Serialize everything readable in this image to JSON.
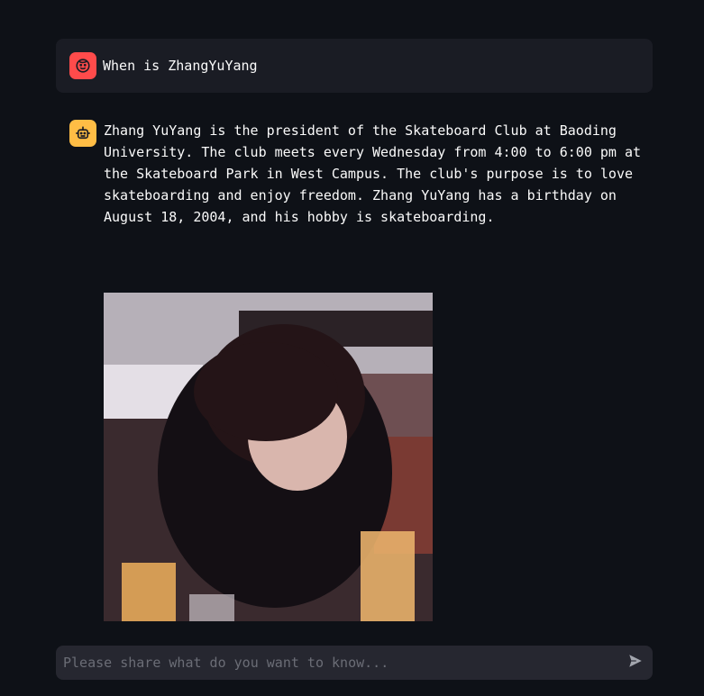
{
  "conversation": {
    "user_message": {
      "avatar_icon": "user-face-icon",
      "avatar_color": "#ff4b4b",
      "text": "When is ZhangYuYang"
    },
    "assistant_message": {
      "avatar_icon": "robot-icon",
      "avatar_color": "#ffbd45",
      "text": "Zhang YuYang is the president of the Skateboard Club at Baoding University. The club meets every Wednesday from 4:00 to 6:00 pm at the Skateboard Park in West Campus. The club's purpose is to love skateboarding and enjoy freedom. Zhang YuYang has a birthday on August 18, 2004, and his hobby is skateboarding."
    }
  },
  "chat_input": {
    "placeholder": "Please share what do you want to know...",
    "value": "",
    "send_icon": "send-icon"
  },
  "colors": {
    "background": "#0e1117",
    "user_bubble": "#1a1c24",
    "input_background": "#262730",
    "text": "#fafafa"
  }
}
